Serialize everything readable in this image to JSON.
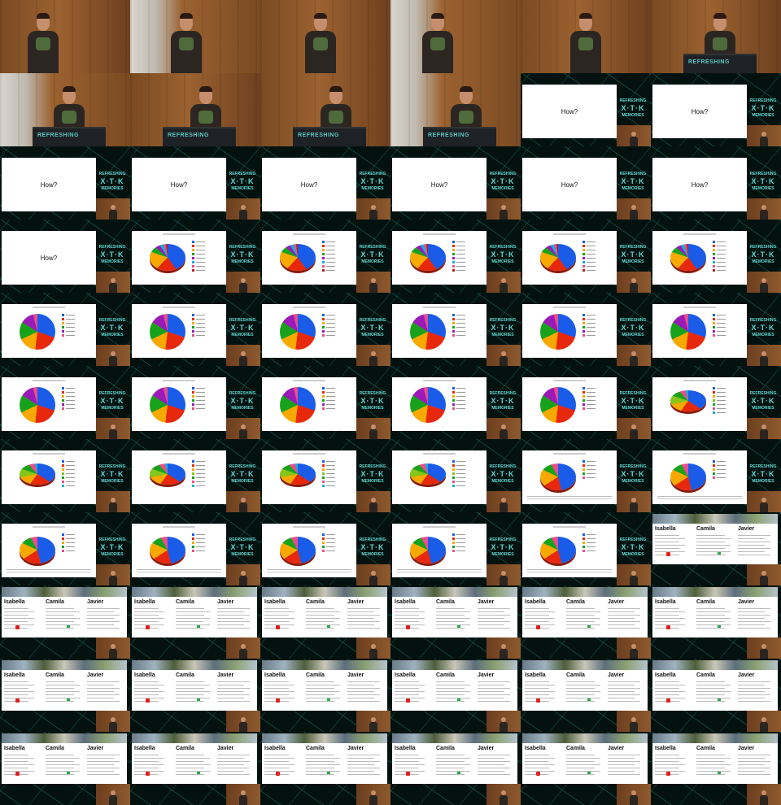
{
  "grid": {
    "columns": 6,
    "rows": 11
  },
  "how_slide": {
    "text": "How?"
  },
  "podium_logo": "REFRESHING",
  "badge": {
    "line1": "REFRESHING",
    "line2": "X·T·K",
    "line3": "MEMORIES"
  },
  "name_slide": {
    "names": [
      "Isabella",
      "Camila",
      "Javier"
    ]
  },
  "pie_colors": {
    "blue": "#1a5ce8",
    "red": "#e8280c",
    "orange": "#f7a900",
    "green": "#18a21c",
    "purple": "#9a1bb8",
    "cyan": "#0fb3d6",
    "pink": "#e94d8b",
    "lime": "#86c51a",
    "darkred": "#b41f1f"
  },
  "tiles": [
    {
      "kind": "stage",
      "speaker_x": 0.25,
      "podium": false
    },
    {
      "kind": "stage",
      "speaker_x": 0.35,
      "podium": false,
      "lightwall": true
    },
    {
      "kind": "stage",
      "speaker_x": 0.38,
      "podium": false
    },
    {
      "kind": "stage",
      "speaker_x": 0.28,
      "podium": false,
      "lightwall": true
    },
    {
      "kind": "stage",
      "speaker_x": 0.42,
      "podium": false
    },
    {
      "kind": "stage",
      "speaker_x": 0.45,
      "podium": true
    },
    {
      "kind": "stage",
      "speaker_x": 0.45,
      "podium": true,
      "lightwall": true
    },
    {
      "kind": "stage",
      "speaker_x": 0.5,
      "podium": true
    },
    {
      "kind": "stage",
      "speaker_x": 0.5,
      "podium": true
    },
    {
      "kind": "stage",
      "speaker_x": 0.5,
      "podium": true,
      "lightwall": true
    },
    {
      "kind": "slide",
      "slide": "how"
    },
    {
      "kind": "slide",
      "slide": "how"
    },
    {
      "kind": "slide",
      "slide": "how"
    },
    {
      "kind": "slide",
      "slide": "how"
    },
    {
      "kind": "slide",
      "slide": "how"
    },
    {
      "kind": "slide",
      "slide": "how"
    },
    {
      "kind": "slide",
      "slide": "how"
    },
    {
      "kind": "slide",
      "slide": "how"
    },
    {
      "kind": "slide",
      "slide": "how"
    },
    {
      "kind": "slide",
      "slide": "pie1"
    },
    {
      "kind": "slide",
      "slide": "pie1"
    },
    {
      "kind": "slide",
      "slide": "pie1"
    },
    {
      "kind": "slide",
      "slide": "pie1"
    },
    {
      "kind": "slide",
      "slide": "pie1"
    },
    {
      "kind": "slide",
      "slide": "pie2"
    },
    {
      "kind": "slide",
      "slide": "pie2"
    },
    {
      "kind": "slide",
      "slide": "pie2"
    },
    {
      "kind": "slide",
      "slide": "pie2"
    },
    {
      "kind": "slide",
      "slide": "pie2"
    },
    {
      "kind": "slide",
      "slide": "pie2"
    },
    {
      "kind": "slide",
      "slide": "pie2"
    },
    {
      "kind": "slide",
      "slide": "pie2"
    },
    {
      "kind": "slide",
      "slide": "pie2"
    },
    {
      "kind": "slide",
      "slide": "pie2"
    },
    {
      "kind": "slide",
      "slide": "pie2"
    },
    {
      "kind": "slide",
      "slide": "pie3d"
    },
    {
      "kind": "slide",
      "slide": "pie3d"
    },
    {
      "kind": "slide",
      "slide": "pie3d"
    },
    {
      "kind": "slide",
      "slide": "pie3d"
    },
    {
      "kind": "slide",
      "slide": "pie3d"
    },
    {
      "kind": "slide",
      "slide": "pie4"
    },
    {
      "kind": "slide",
      "slide": "pie4"
    },
    {
      "kind": "slide",
      "slide": "pie4"
    },
    {
      "kind": "slide",
      "slide": "pie4"
    },
    {
      "kind": "slide",
      "slide": "pie4"
    },
    {
      "kind": "slide",
      "slide": "pie4"
    },
    {
      "kind": "slide",
      "slide": "pie4"
    },
    {
      "kind": "slide",
      "slide": "names",
      "wide": true
    },
    {
      "kind": "slide",
      "slide": "names",
      "wide": true
    },
    {
      "kind": "slide",
      "slide": "names",
      "wide": true
    },
    {
      "kind": "slide",
      "slide": "names",
      "wide": true
    },
    {
      "kind": "slide",
      "slide": "names",
      "wide": true
    },
    {
      "kind": "slide",
      "slide": "names",
      "wide": true
    },
    {
      "kind": "slide",
      "slide": "names",
      "wide": true
    },
    {
      "kind": "slide",
      "slide": "names",
      "wide": true
    },
    {
      "kind": "slide",
      "slide": "names",
      "wide": true
    },
    {
      "kind": "slide",
      "slide": "names",
      "wide": true
    },
    {
      "kind": "slide",
      "slide": "names",
      "wide": true
    },
    {
      "kind": "slide",
      "slide": "names",
      "wide": true
    },
    {
      "kind": "slide",
      "slide": "names",
      "wide": true
    },
    {
      "kind": "slide",
      "slide": "names",
      "wide": true
    },
    {
      "kind": "slide",
      "slide": "names",
      "wide": true
    },
    {
      "kind": "slide",
      "slide": "names",
      "wide": true
    },
    {
      "kind": "slide",
      "slide": "names",
      "wide": true
    },
    {
      "kind": "slide",
      "slide": "names",
      "wide": true
    },
    {
      "kind": "slide",
      "slide": "names",
      "wide": true
    }
  ]
}
